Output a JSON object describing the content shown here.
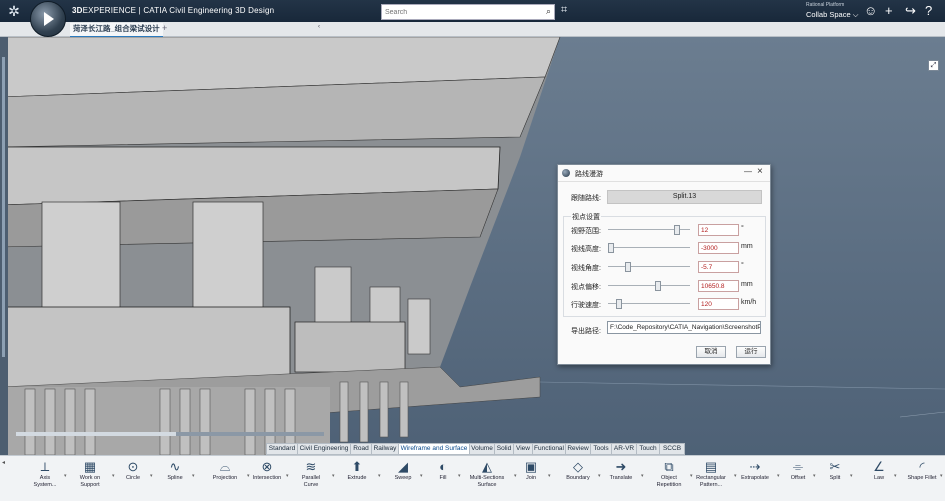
{
  "header": {
    "app_title_bold": "3D",
    "app_title_rest": "EXPERIENCE | CATIA Civil Engineering 3D Design",
    "search_placeholder": "Search",
    "platform": "Rational Platform",
    "collab_space": "Collab Space ⌵"
  },
  "tabs": {
    "document": "菏泽长江路_组合梁试设计",
    "add": "+"
  },
  "dialog": {
    "title": "路线漫游",
    "follow_label": "跟随路线:",
    "follow_value": "Split.13",
    "group_label": "视点设置",
    "rows": [
      {
        "label": "视野范围:",
        "value": "12",
        "unit": "°",
        "slider_pos": 0.84
      },
      {
        "label": "视线高度:",
        "value": "-3000",
        "unit": "mm",
        "slider_pos": 0.0
      },
      {
        "label": "视线角度:",
        "value": "-5.7",
        "unit": "°",
        "slider_pos": 0.22
      },
      {
        "label": "视点偏移:",
        "value": "10650.8",
        "unit": "mm",
        "slider_pos": 0.6
      },
      {
        "label": "行驶速度:",
        "value": "120",
        "unit": "km/h",
        "slider_pos": 0.1
      }
    ],
    "export_label": "导出路径:",
    "export_path": "F:\\Code_Repository\\CATIA_Navigation\\ScreenshotPat",
    "cancel": "取消",
    "run": "运行"
  },
  "workbench_tabs": [
    "Standard",
    "Civil Engineering",
    "Road",
    "Railway",
    "Wireframe and Surface",
    "Volume",
    "Solid",
    "View",
    "Functional",
    "Review",
    "Tools",
    "AR-VR",
    "Touch",
    "SCCB"
  ],
  "active_workbench_tab": "Wireframe and Surface",
  "tools": [
    {
      "name": "axis-system",
      "label": "Axis System...",
      "icon": "⟂"
    },
    {
      "name": "work-on-support",
      "label": "Work on Support",
      "icon": "▦"
    },
    {
      "name": "circle",
      "label": "Circle",
      "icon": "⊙"
    },
    {
      "name": "spline",
      "label": "Spline",
      "icon": "∿"
    },
    {
      "name": "projection",
      "label": "Projection",
      "icon": "⌓"
    },
    {
      "name": "intersection",
      "label": "Intersection",
      "icon": "⊗"
    },
    {
      "name": "parallel-curve",
      "label": "Parallel Curve",
      "icon": "≋"
    },
    {
      "name": "extrude",
      "label": "Extrude",
      "icon": "⬆"
    },
    {
      "name": "sweep",
      "label": "Sweep",
      "icon": "◢"
    },
    {
      "name": "fill",
      "label": "Fill",
      "icon": "◐"
    },
    {
      "name": "multi-sections-surface",
      "label": "Multi-Sections Surface",
      "icon": "◭"
    },
    {
      "name": "join",
      "label": "Join",
      "icon": "▣"
    },
    {
      "name": "boundary",
      "label": "Boundary",
      "icon": "◇"
    },
    {
      "name": "translate",
      "label": "Translate",
      "icon": "➜"
    },
    {
      "name": "object-repetition",
      "label": "Object Repetition",
      "icon": "⧉"
    },
    {
      "name": "rectangular-pattern",
      "label": "Rectangular Pattern...",
      "icon": "▤"
    },
    {
      "name": "extrapolate",
      "label": "Extrapolate",
      "icon": "⇢"
    },
    {
      "name": "offset",
      "label": "Offset",
      "icon": "⌯"
    },
    {
      "name": "split",
      "label": "Split",
      "icon": "✂"
    },
    {
      "name": "law",
      "label": "Law",
      "icon": "∠"
    },
    {
      "name": "shape-fillet",
      "label": "Shape Fillet",
      "icon": "◜"
    }
  ]
}
